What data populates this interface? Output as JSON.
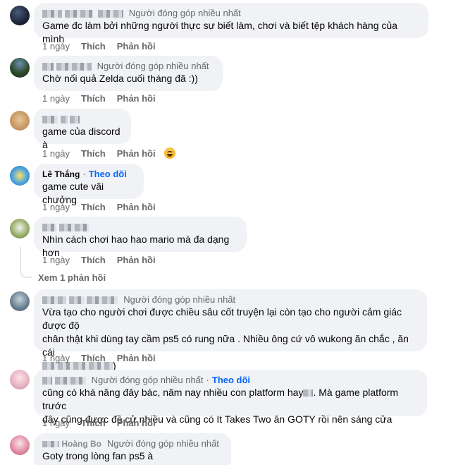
{
  "labels": {
    "time": "1 ngày",
    "like": "Thích",
    "reply": "Phản hồi",
    "top_contributor": "Người đóng góp nhiều nhất",
    "follow": "Theo dõi",
    "view_replies": "Xem 1 phản hồi"
  },
  "comments": [
    {
      "name": "",
      "text": "Game đc làm bởi những người thực sự biết làm, chơi và biết tệp khách hàng của mình"
    },
    {
      "name": "",
      "text": "Chờ nối quả Zelda cuối tháng đã :))"
    },
    {
      "name": "",
      "text": "game của discord à"
    },
    {
      "name": "Lê Thắng",
      "text": "game cute vãi chưởng"
    },
    {
      "name": "",
      "text": "Nhìn cách chơi hao hao mario mà đa dạng hơn"
    },
    {
      "name": "",
      "text_line1": "Vừa tạo cho người chơi được chiều sâu cốt truyện lại còn tạo cho người cảm giác được độ",
      "text_line2": "chân thật khi dùng tay cầm ps5 có rung nữa . Nhiều ông cứ vô wukong ăn chắc , ăn cái",
      "text_line3": ")"
    },
    {
      "name": "",
      "text_line1": "cũng có khá năng đây bác, năm nay nhiều con platform hay",
      "text_line1b": ". Mà game platform trước",
      "text_line2": "đây cũng được đề cử nhiều và cũng có It Takes Two ăn GOTY rồi nên sáng cửa"
    },
    {
      "name": "Hoàng Bo",
      "text": "Goty trong lòng fan ps5 à"
    }
  ],
  "colors": {
    "bubble": "#f0f2f5",
    "secondary_text": "#65676b",
    "link": "#0866ff"
  },
  "icons": [
    "avatar",
    "laughing-emoji-icon"
  ]
}
